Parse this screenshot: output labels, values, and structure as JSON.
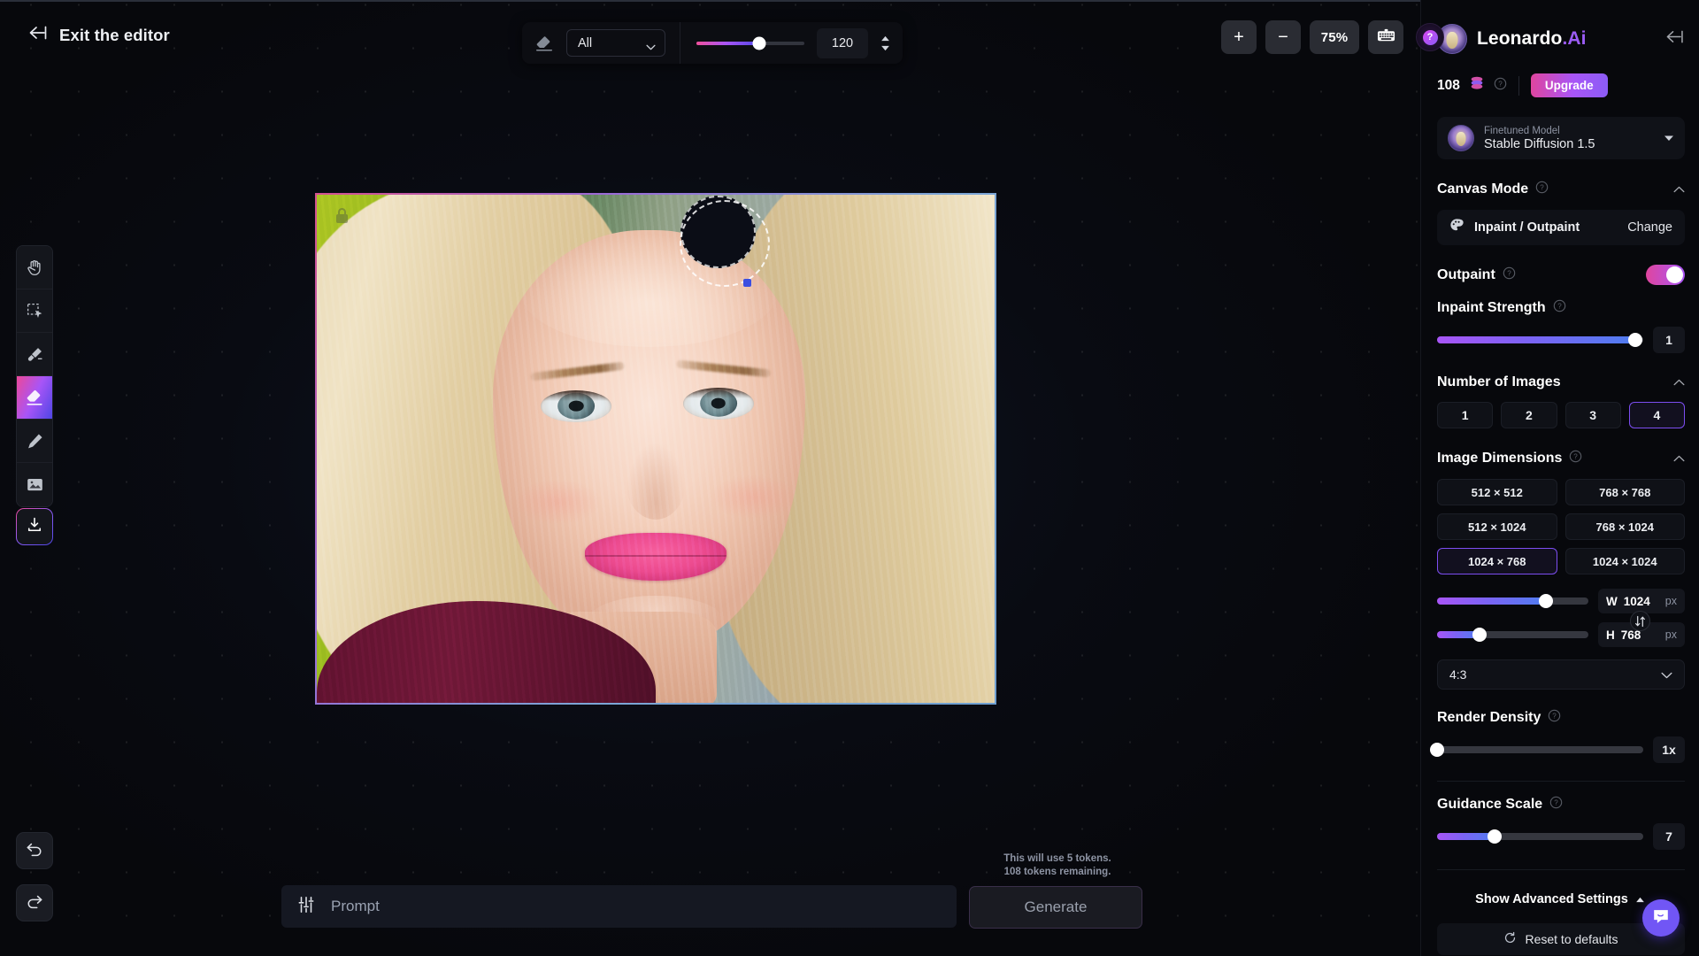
{
  "exit": {
    "label": "Exit the editor",
    "icon": "arrow-left-exit-icon"
  },
  "brush_toolbar": {
    "tool_icon": "eraser-icon",
    "layer_select": {
      "value": "All",
      "caret": "chevron-down-icon"
    },
    "size_slider": {
      "value": 58,
      "min": 0,
      "max": 100
    },
    "size_value": "120",
    "stepper": {
      "up": "caret-up-icon",
      "down": "caret-down-icon"
    }
  },
  "zoom_controls": {
    "zoom_in": "+",
    "zoom_out": "−",
    "zoom_level": "75%",
    "keyboard_icon": "keyboard-icon",
    "help_label": "?"
  },
  "tools": [
    {
      "name": "hand-tool",
      "icon": "hand-icon",
      "active": false
    },
    {
      "name": "select-tool",
      "icon": "marquee-select-icon",
      "active": false
    },
    {
      "name": "mask-brush-tool",
      "icon": "paint-brush-icon",
      "active": false
    },
    {
      "name": "eraser-tool",
      "icon": "eraser-icon",
      "active": true
    },
    {
      "name": "draw-tool",
      "icon": "pencil-icon",
      "active": false
    },
    {
      "name": "image-tool",
      "icon": "image-icon",
      "active": false
    }
  ],
  "download": {
    "icon": "download-icon"
  },
  "history": {
    "undo_icon": "undo-arrow-icon",
    "redo_icon": "redo-arrow-icon"
  },
  "canvas": {
    "lock_icon": "lock-icon",
    "mask_region": "dashed-brush-circle"
  },
  "prompt": {
    "settings_icon": "sliders-icon",
    "placeholder": "Prompt",
    "value": ""
  },
  "tokens": {
    "line1": "This will use 5 tokens.",
    "line2": "108 tokens remaining."
  },
  "generate": {
    "label": "Generate",
    "disabled": true
  },
  "panel": {
    "brand": {
      "name": "Leonardo",
      "suffix": ".Ai",
      "avatar": "leonardo-avatar-icon"
    },
    "collapse_icon": "collapse-panel-icon",
    "credits": {
      "count": "108",
      "coin_icon": "token-coin-icon",
      "help_icon": "help-circle-icon",
      "upgrade_label": "Upgrade"
    },
    "model": {
      "caption": "Finetuned Model",
      "name": "Stable Diffusion 1.5",
      "avatar": "model-avatar-icon",
      "caret": "caret-down-icon"
    },
    "canvas_mode": {
      "title": "Canvas Mode",
      "help_icon": "help-circle-icon",
      "collapse_icon": "chevron-up-icon",
      "mode_icon": "palette-icon",
      "mode_label": "Inpaint / Outpaint",
      "change_label": "Change"
    },
    "outpaint": {
      "title": "Outpaint",
      "help_icon": "help-circle-icon",
      "enabled": true
    },
    "inpaint_strength": {
      "title": "Inpaint Strength",
      "help_icon": "help-circle-icon",
      "value": "1",
      "slider_pct": 96
    },
    "number_of_images": {
      "title": "Number of Images",
      "collapse_icon": "chevron-up-icon",
      "options": [
        "1",
        "2",
        "3",
        "4"
      ],
      "selected_index": 3
    },
    "image_dimensions": {
      "title": "Image Dimensions",
      "help_icon": "help-circle-icon",
      "collapse_icon": "chevron-up-icon",
      "presets": [
        "512 × 512",
        "768 × 768",
        "512 × 1024",
        "768 × 1024",
        "1024 × 768",
        "1024 × 1024"
      ],
      "selected_index": 4,
      "width": {
        "key": "W",
        "value": "1024",
        "unit": "px",
        "slider_pct": 72
      },
      "height": {
        "key": "H",
        "value": "768",
        "unit": "px",
        "slider_pct": 28
      },
      "swap_icon": "swap-dimensions-icon",
      "aspect_ratio": "4:3",
      "aspect_caret": "chevron-down-icon"
    },
    "render_density": {
      "title": "Render Density",
      "help_icon": "help-circle-icon",
      "value": "1x",
      "slider_pct": 0
    },
    "guidance_scale": {
      "title": "Guidance Scale",
      "help_icon": "help-circle-icon",
      "value": "7",
      "slider_pct": 28
    },
    "advanced": {
      "label": "Show Advanced Settings",
      "caret": "chevron-up-icon"
    },
    "reset": {
      "label": "Reset to defaults",
      "icon": "refresh-ccw-icon"
    }
  },
  "intercom": {
    "icon": "chat-bubble-icon"
  }
}
